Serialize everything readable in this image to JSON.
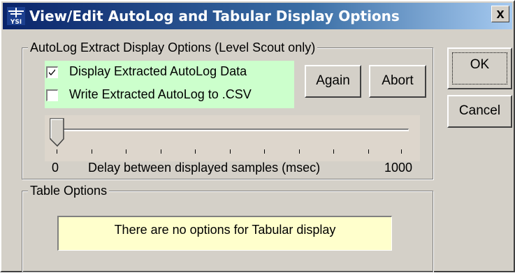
{
  "window": {
    "title": "View/Edit AutoLog and Tabular Display Options",
    "icon_text": "YSI",
    "close_label": "x"
  },
  "autolog_group": {
    "legend": "AutoLog Extract Display Options (Level Scout only)",
    "display_extracted": {
      "label": "Display Extracted AutoLog Data",
      "checked": true
    },
    "write_csv": {
      "label": "Write Extracted AutoLog to .CSV",
      "checked": false
    },
    "again_label": "Again",
    "abort_label": "Abort",
    "slider": {
      "min_label": "0",
      "max_label": "1000",
      "caption": "Delay between displayed samples (msec)",
      "value": 0,
      "min": 0,
      "max": 1000
    }
  },
  "table_group": {
    "legend": "Table Options",
    "notice": "There are no options for Tabular display"
  },
  "buttons": {
    "ok_label": "OK",
    "cancel_label": "Cancel"
  },
  "colors": {
    "dialog_face": "#d4d0c8",
    "title_start": "#0a246a",
    "title_end": "#a6caf0",
    "checkbox_panel": "#ccffcc",
    "notice_panel": "#ffffcc",
    "slider_panel": "#ddd6cc"
  }
}
